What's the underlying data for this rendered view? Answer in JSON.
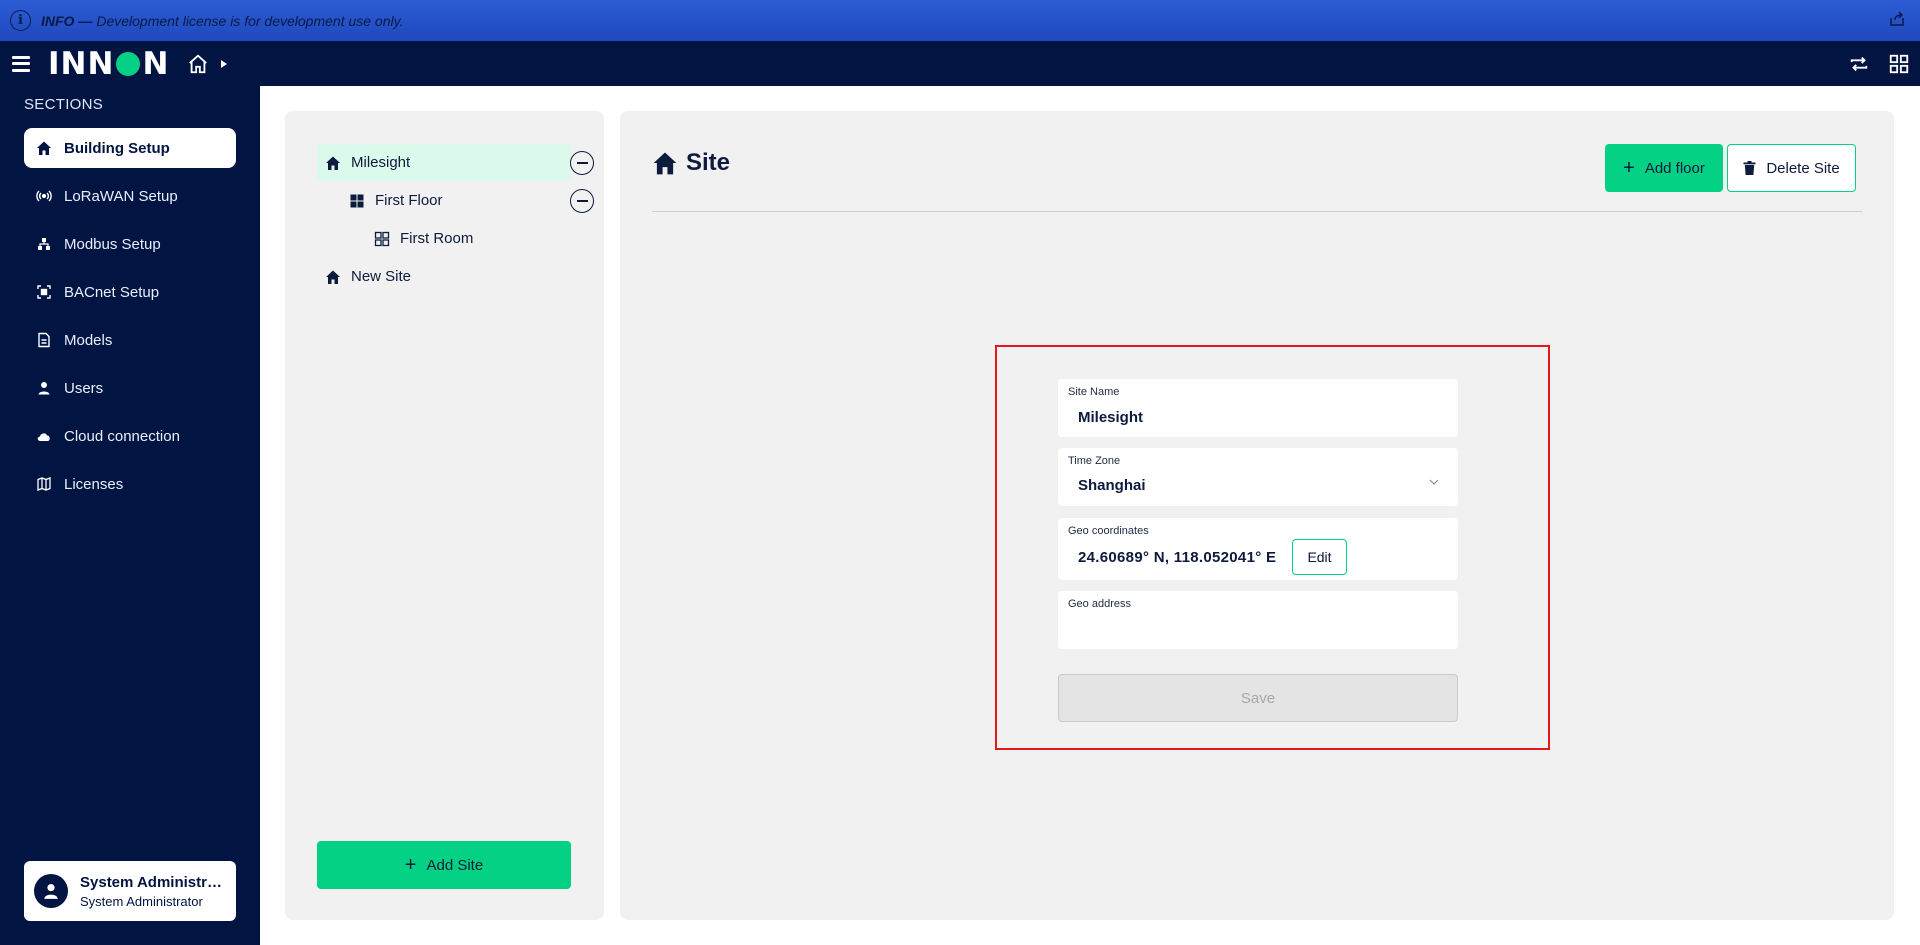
{
  "banner": {
    "label": "INFO —",
    "message": "Development license is for development use only."
  },
  "header": {
    "logo": "INNON"
  },
  "sidebar": {
    "sections_title": "SECTIONS",
    "items": [
      {
        "label": "Building Setup",
        "icon": "home-icon",
        "active": true
      },
      {
        "label": "LoRaWAN Setup",
        "icon": "broadcast-icon",
        "active": false
      },
      {
        "label": "Modbus Setup",
        "icon": "network-icon",
        "active": false
      },
      {
        "label": "BACnet Setup",
        "icon": "scan-icon",
        "active": false
      },
      {
        "label": "Models",
        "icon": "document-icon",
        "active": false
      },
      {
        "label": "Users",
        "icon": "user-icon",
        "active": false
      },
      {
        "label": "Cloud connection",
        "icon": "cloud-icon",
        "active": false
      },
      {
        "label": "Licenses",
        "icon": "map-icon",
        "active": false
      }
    ],
    "user": {
      "name": "System Administrator",
      "role": "System Administrator"
    }
  },
  "tree": {
    "items": [
      {
        "label": "Milesight",
        "type": "site",
        "selected": true
      },
      {
        "label": "First Floor",
        "type": "floor"
      },
      {
        "label": "First Room",
        "type": "room"
      },
      {
        "label": "New Site",
        "type": "site"
      }
    ],
    "add_site_label": "Add Site"
  },
  "content": {
    "title": "Site",
    "add_floor_label": "Add floor",
    "delete_site_label": "Delete Site",
    "form": {
      "site_name_label": "Site Name",
      "site_name_value": "Milesight",
      "time_zone_label": "Time Zone",
      "time_zone_value": "Shanghai",
      "geo_coordinates_label": "Geo coordinates",
      "geo_coordinates_value": "24.60689° N, 118.052041° E",
      "edit_label": "Edit",
      "geo_address_label": "Geo address",
      "geo_address_value": "",
      "save_label": "Save"
    }
  },
  "colors": {
    "brand_navy": "#021442",
    "accent_green": "#04d184",
    "banner_blue": "#2359cf",
    "highlight_frame": "#e3191c"
  }
}
